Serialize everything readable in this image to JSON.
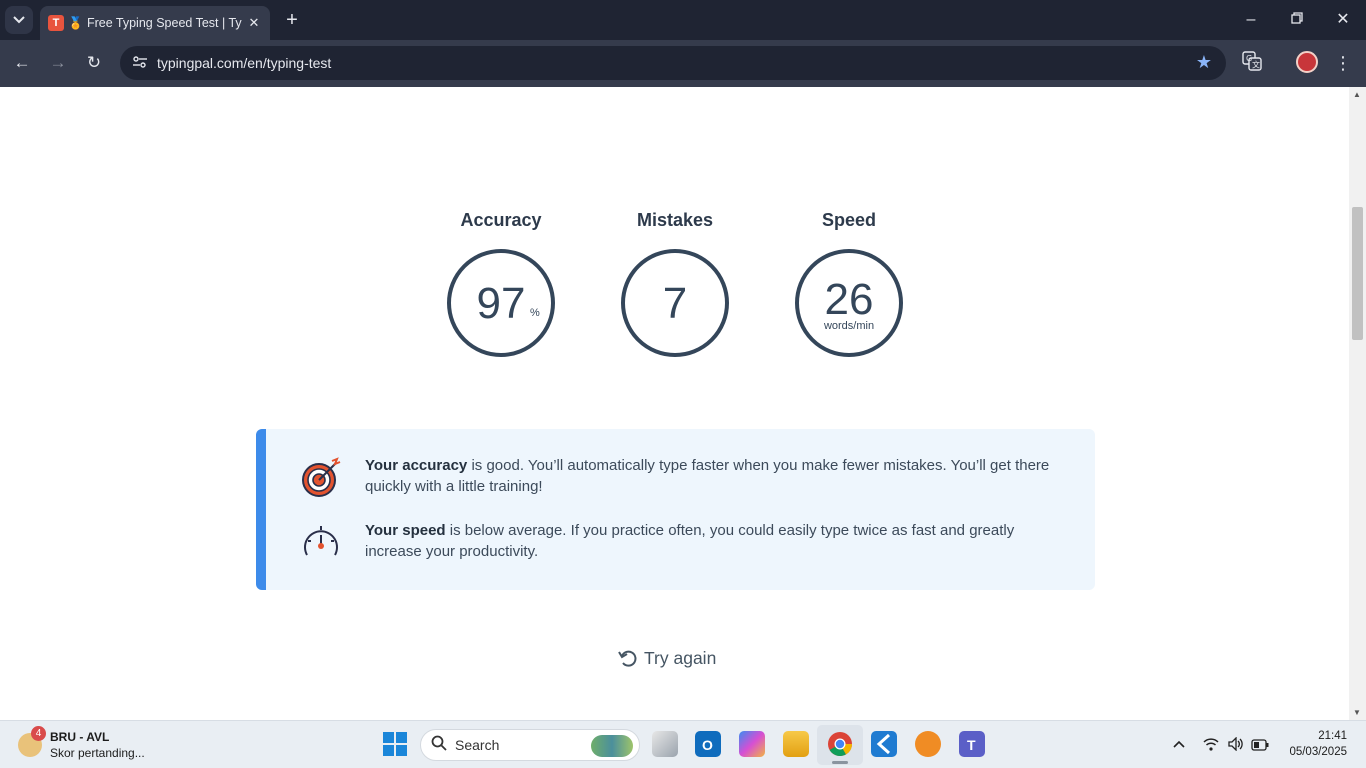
{
  "browser": {
    "tab_favicon_letter": "T",
    "tab_title": "Free Typing Speed Test | Typing Pal",
    "new_tab": "+",
    "url": "typingpal.com/en/typing-test"
  },
  "stats": {
    "accuracy": {
      "label": "Accuracy",
      "value": "97",
      "unit": "%"
    },
    "mistakes": {
      "label": "Mistakes",
      "value": "7"
    },
    "speed": {
      "label": "Speed",
      "value": "26",
      "unit": "words/min"
    }
  },
  "feedback": {
    "accuracy_bold": "Your accuracy",
    "accuracy_text": " is good. You’ll automatically type faster when you make fewer mistakes. You’ll get there quickly with a little training!",
    "speed_bold": "Your speed",
    "speed_text": " is below average. If you practice often, you could easily type twice as fast and greatly increase your productivity."
  },
  "try_again": "Try again",
  "taskbar": {
    "weather_badge": "4",
    "weather_title": "BRU - AVL",
    "weather_subtitle": "Skor pertanding...",
    "search_label": "Search",
    "time": "21:41",
    "date": "05/03/2025"
  },
  "colors": {
    "accent": "#3d8bea",
    "ring": "#34465a",
    "feedback_bg": "#eef6fd",
    "target_red": "#e3532f"
  },
  "icons": [
    "tab-list-icon",
    "close-icon",
    "back-icon",
    "forward-icon",
    "reload-icon",
    "site-info-icon",
    "star-icon",
    "translate-icon",
    "menu-icon",
    "target-icon",
    "speedometer-icon",
    "refresh-icon",
    "windows-start-icon",
    "search-icon",
    "wifi-icon",
    "volume-icon",
    "battery-icon"
  ]
}
